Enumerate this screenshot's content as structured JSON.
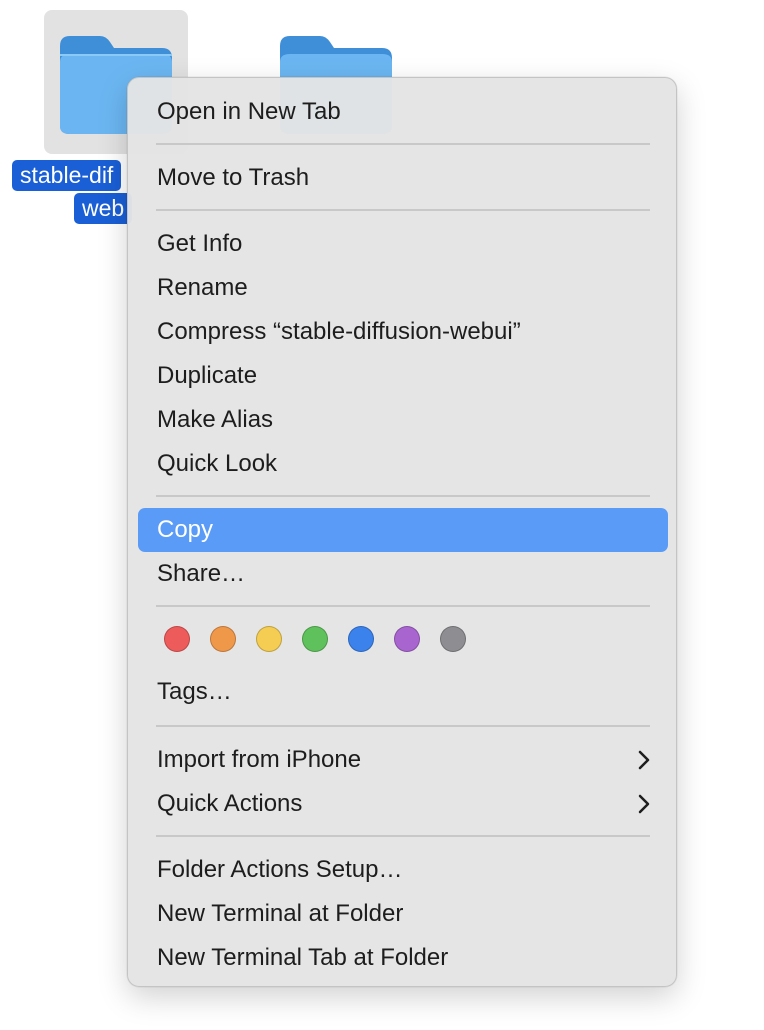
{
  "desktop": {
    "folders": [
      {
        "label_line1": "stable-dif",
        "label_line2": "web",
        "selected": true
      },
      {
        "label_line1": "",
        "label_line2": "",
        "selected": false
      }
    ],
    "folder_color": "#6bb6f2",
    "selection_color": "#1a5fd6"
  },
  "context_menu": {
    "items": {
      "open_new_tab": "Open in New Tab",
      "move_to_trash": "Move to Trash",
      "get_info": "Get Info",
      "rename": "Rename",
      "compress": "Compress “stable-diffusion-webui”",
      "duplicate": "Duplicate",
      "make_alias": "Make Alias",
      "quick_look": "Quick Look",
      "copy": "Copy",
      "share": "Share…",
      "tags": "Tags…",
      "import_iphone": "Import from iPhone",
      "quick_actions": "Quick Actions",
      "folder_actions_setup": "Folder Actions Setup…",
      "new_terminal": "New Terminal at Folder",
      "new_terminal_tab": "New Terminal Tab at Folder"
    },
    "highlighted_item": "copy",
    "highlight_color": "#5a9bf8",
    "tag_colors": [
      {
        "name": "red",
        "color": "#ee5b5b"
      },
      {
        "name": "orange",
        "color": "#f0984a"
      },
      {
        "name": "yellow",
        "color": "#f4cd52"
      },
      {
        "name": "green",
        "color": "#5fc15c"
      },
      {
        "name": "blue",
        "color": "#3b82ec"
      },
      {
        "name": "purple",
        "color": "#a865cf"
      },
      {
        "name": "gray",
        "color": "#8e8e92"
      }
    ],
    "submenu_icon": "chevron-right-icon"
  }
}
